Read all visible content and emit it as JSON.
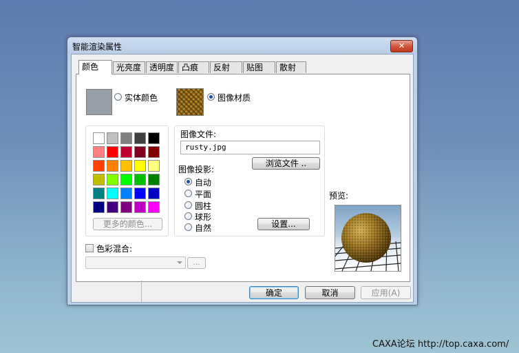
{
  "window": {
    "title": "智能渲染属性",
    "close_label": "✕"
  },
  "tabs": [
    {
      "label": "颜色",
      "active": true
    },
    {
      "label": "光亮度",
      "active": false
    },
    {
      "label": "透明度",
      "active": false
    },
    {
      "label": "凸痕",
      "active": false
    },
    {
      "label": "反射",
      "active": false
    },
    {
      "label": "贴图",
      "active": false
    },
    {
      "label": "散射",
      "active": false
    }
  ],
  "color_tab": {
    "solid_color_label": "实体颜色",
    "solid_color_swatch": "#969ea8",
    "image_material_label": "图像材质",
    "selected_mode": "image_material",
    "palette": [
      [
        "#ffffff",
        "#c0c0c0",
        "#808080",
        "#404040",
        "#000000"
      ],
      [
        "#ff8080",
        "#ff0000",
        "#c00030",
        "#800020",
        "#800000"
      ],
      [
        "#ff4000",
        "#ff8000",
        "#ffc000",
        "#ffff00",
        "#ffff80"
      ],
      [
        "#c0c000",
        "#80ff00",
        "#00ff00",
        "#00c000",
        "#008000"
      ],
      [
        "#008080",
        "#00ffff",
        "#0080ff",
        "#0000ff",
        "#0000c0"
      ],
      [
        "#000080",
        "#400080",
        "#800080",
        "#c000c0",
        "#ff00ff"
      ]
    ],
    "more_colors_label": "更多的颜色...",
    "image_file_label": "图像文件:",
    "image_file_value": "rusty.jpg",
    "browse_label": "浏览文件 ..",
    "projection_label": "图像投影:",
    "projections": [
      "自动",
      "平面",
      "圆柱",
      "球形",
      "自然"
    ],
    "selected_projection": "自动",
    "settings_label": "设置...",
    "preview_label": "预览:",
    "color_blend_label": "色彩混合:",
    "color_blend_checked": false,
    "ellipsis_label": "..."
  },
  "footer": {
    "ok_label": "确定",
    "cancel_label": "取消",
    "apply_label": "应用(A)"
  },
  "watermark": "CAXA论坛 http://top.caxa.com/"
}
